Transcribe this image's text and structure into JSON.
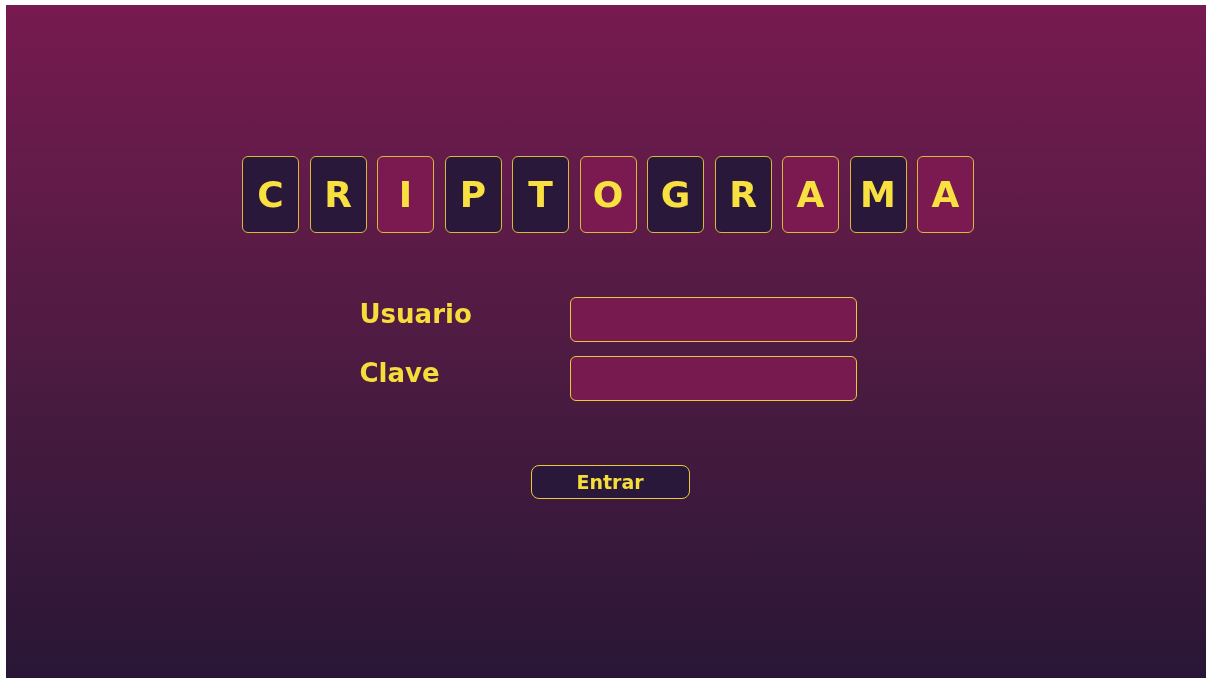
{
  "title_tiles": [
    {
      "letter": "C",
      "color": "#2a183a"
    },
    {
      "letter": "R",
      "color": "#2a183a"
    },
    {
      "letter": "I",
      "color": "#7a1a50"
    },
    {
      "letter": "P",
      "color": "#2a183a"
    },
    {
      "letter": "T",
      "color": "#2a183a"
    },
    {
      "letter": "O",
      "color": "#7a1a50"
    },
    {
      "letter": "G",
      "color": "#2a183a"
    },
    {
      "letter": "R",
      "color": "#2a183a"
    },
    {
      "letter": "A",
      "color": "#7a1a50"
    },
    {
      "letter": "M",
      "color": "#2a183a"
    },
    {
      "letter": "A",
      "color": "#7a1a50"
    }
  ],
  "form": {
    "fields": [
      {
        "label": "Usuario"
      },
      {
        "label": "Clave"
      }
    ],
    "button": "Entrar"
  }
}
